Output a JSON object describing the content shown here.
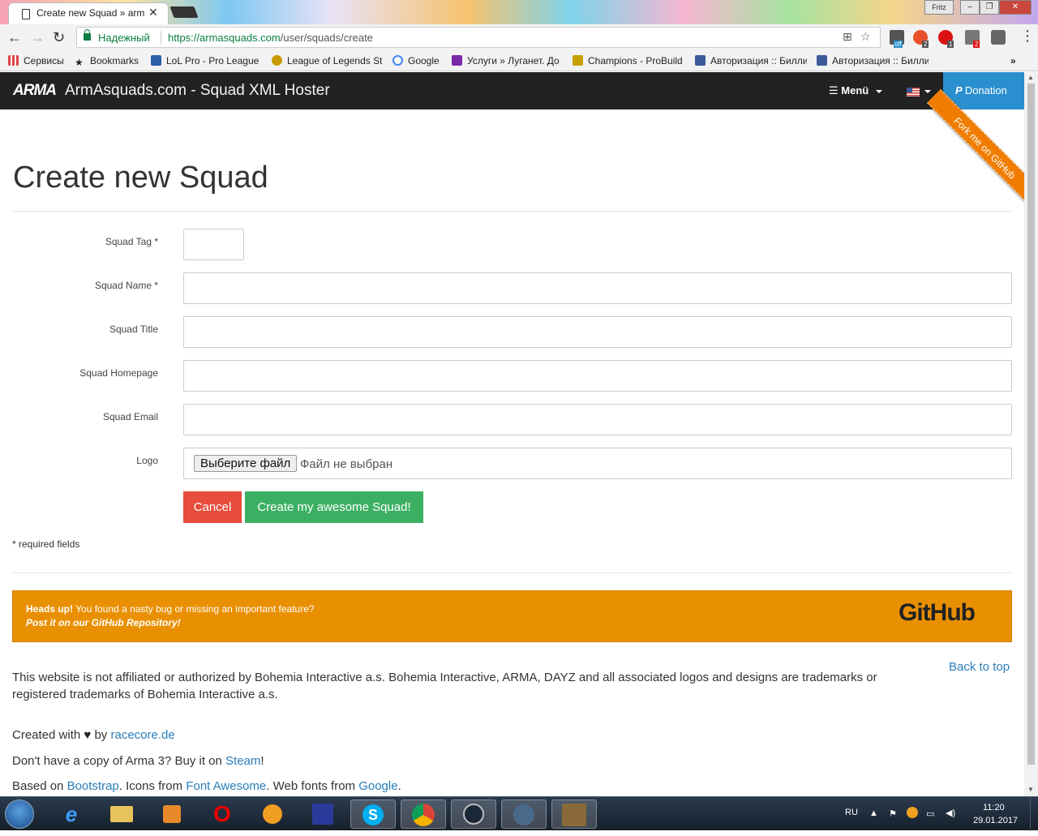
{
  "browser": {
    "tab_title": "Create new Squad » arm",
    "user": "Fritz",
    "secure_label": "Надежный",
    "url_host": "https://armasquads.com",
    "url_path": "/user/squads/create",
    "bookmarks": [
      {
        "label": "Сервисы",
        "color": "#d44"
      },
      {
        "label": "Bookmarks",
        "color": "#222"
      },
      {
        "label": "LoL Pro - Pro League",
        "color": "#2a5fa8"
      },
      {
        "label": "League of Legends St",
        "color": "#c89b00"
      },
      {
        "label": "Google",
        "color": "#4285f4"
      },
      {
        "label": "Услуги » Луганет. До",
        "color": "#7a2aa8"
      },
      {
        "label": "Champions - ProBuild",
        "color": "#c8a000"
      },
      {
        "label": "Авторизация :: Билли",
        "color": "#3a5a9a"
      },
      {
        "label": "Авторизация :: Билли",
        "color": "#3a5a9a"
      }
    ],
    "ext_badges": [
      "off",
      "2",
      "1",
      "2"
    ]
  },
  "navbar": {
    "logo": "ARMA",
    "brand": "ArmAsquads.com - Squad XML Hoster",
    "menu_label": "Menü",
    "donation_label": "Donation",
    "ribbon": "Fork me on GitHub"
  },
  "form": {
    "title": "Create new Squad",
    "fields": [
      {
        "label": "Squad Tag *",
        "value": ""
      },
      {
        "label": "Squad Name *",
        "value": ""
      },
      {
        "label": "Squad Title",
        "value": ""
      },
      {
        "label": "Squad Homepage",
        "value": ""
      },
      {
        "label": "Squad Email",
        "value": ""
      },
      {
        "label": "Logo",
        "file_button": "Выберите файл",
        "file_status": "Файл не выбран"
      }
    ],
    "cancel_label": "Cancel",
    "submit_label": "Create my awesome Squad!",
    "required_note": "* required fields"
  },
  "alert": {
    "strong": "Heads up!",
    "text": " You found a nasty bug or missing an important feature?",
    "link": "Post it on our GitHub Repository!",
    "logo": "GitHub",
    "bg_color": "#e99002"
  },
  "footer": {
    "disclaimer": "This website is not affiliated or authorized by Bohemia Interactive a.s. Bohemia Interactive, ARMA, DAYZ and all associated logos and designs are trademarks or registered trademarks of Bohemia Interactive a.s.",
    "back_to_top": "Back to top",
    "created_prefix": "Created with",
    "created_by": " by ",
    "created_link": "racecore.de",
    "arma_prefix": "Don't have a copy of Arma 3? Buy it on ",
    "arma_link": "Steam",
    "arma_suffix": "!",
    "based_prefix": "Based on ",
    "bootstrap": "Bootstrap",
    "icons_from": ". Icons from ",
    "fontawesome": "Font Awesome",
    "fonts_from": ". Web fonts from ",
    "google": "Google",
    "end": "."
  },
  "taskbar": {
    "lang": "RU",
    "time": "11:20",
    "date": "29.01.2017"
  }
}
